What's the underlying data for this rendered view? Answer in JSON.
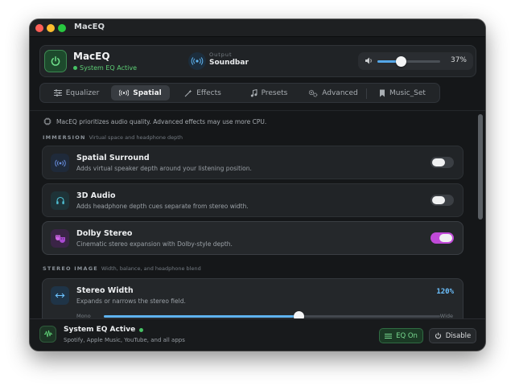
{
  "window": {
    "title": "MacEQ"
  },
  "header": {
    "app_name": "MacEQ",
    "status": "System EQ Active",
    "output_label": "Output",
    "output_device": "Soundbar",
    "volume": {
      "value": 0.37,
      "label": "37%"
    }
  },
  "tabs": [
    {
      "label": "Equalizer",
      "icon": "sliders-icon",
      "active": false
    },
    {
      "label": "Spatial",
      "icon": "spatial-icon",
      "active": true
    },
    {
      "label": "Effects",
      "icon": "wand-icon",
      "active": false
    },
    {
      "label": "Presets",
      "icon": "music-note-icon",
      "active": false
    },
    {
      "label": "Advanced",
      "icon": "gears-icon",
      "active": false
    },
    {
      "label": "Music_Set",
      "icon": "bookmark-icon",
      "active": false
    }
  ],
  "notice": "MacEQ prioritizes audio quality. Advanced effects may use more CPU.",
  "immersion": {
    "heading": "IMMERSION",
    "subheading": "Virtual space and headphone depth",
    "items": [
      {
        "title": "Spatial Surround",
        "desc": "Adds virtual speaker depth around your listening position.",
        "enabled": false,
        "icon": "surround-icon"
      },
      {
        "title": "3D Audio",
        "desc": "Adds headphone depth cues separate from stereo width.",
        "enabled": false,
        "icon": "headphones-icon"
      },
      {
        "title": "Dolby Stereo",
        "desc": "Cinematic stereo expansion with Dolby-style depth.",
        "enabled": true,
        "icon": "theater-masks-icon"
      }
    ]
  },
  "stereo_image": {
    "heading": "STEREO IMAGE",
    "subheading": "Width, balance, and headphone blend",
    "width": {
      "title": "Stereo Width",
      "desc": "Expands or narrows the stereo field.",
      "value_label": "120%",
      "slider_min_label": "Mono",
      "slider_max_label": "Wide",
      "slider_position": 0.58
    }
  },
  "footer": {
    "title": "System EQ Active",
    "desc": "Spotify, Apple Music, YouTube, and all apps",
    "eq_button": "EQ On",
    "disable_button": "Disable"
  },
  "colors": {
    "accent_blue": "#5fb3ef",
    "active_green": "#46c264",
    "toggle_on": "#c04ad8"
  }
}
